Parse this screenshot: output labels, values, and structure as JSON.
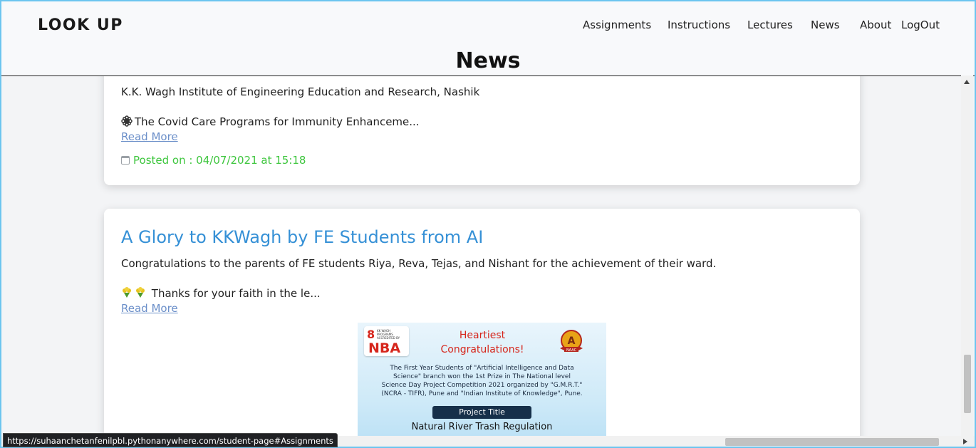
{
  "header": {
    "brand": "LOOK UP",
    "nav": [
      {
        "label": "Assignments"
      },
      {
        "label": "Instructions"
      },
      {
        "label": "Lectures"
      },
      {
        "label": "News"
      },
      {
        "label": "About"
      },
      {
        "label": "LogOut"
      }
    ]
  },
  "page_title": "News",
  "posts": [
    {
      "line1": "K.K. Wagh Institute of Engineering Education and Research, Nashik",
      "excerpt": "The Covid Care Programs for Immunity Enhanceme...",
      "read_more": "Read More",
      "posted": "Posted on : 04/07/2021 at 15:18"
    },
    {
      "title": "A Glory to KKWagh by FE Students from AI",
      "line1": "Congratulations to the parents of FE students Riya, Reva, Tejas, and Nishant for the achievement of their ward.",
      "excerpt": "Thanks for your faith in the le...",
      "read_more": "Read More",
      "poster": {
        "nba_count": "8",
        "nba_small": "KK WAGH PROGRAMS ACCREDITED BY",
        "nba": "NBA",
        "congrats": "Heartiest Congratulations!",
        "naac_grade": "A",
        "naac": "NAAC",
        "body_1": "The First Year Students of \"Artificial Intelligence and Data",
        "body_2": "Science\" branch won the 1st Prize in The National level",
        "body_3": "Science Day Project Competition 2021 organized by \"G.M.R.T.\"",
        "body_4": "(NCRA - TIFR), Pune and \"Indian Institute of Knowledge\", Pune.",
        "project_title_label": "Project Title",
        "project_name": "Natural River Trash Regulation"
      }
    }
  ],
  "status_url": "https://suhaanchetanfenilpbl.pythonanywhere.com/student-page#Assignments",
  "colors": {
    "title_blue": "#3590d6",
    "posted_green": "#3ec63e",
    "link": "#6b8fc9",
    "frame_border": "#6cc5ef"
  }
}
